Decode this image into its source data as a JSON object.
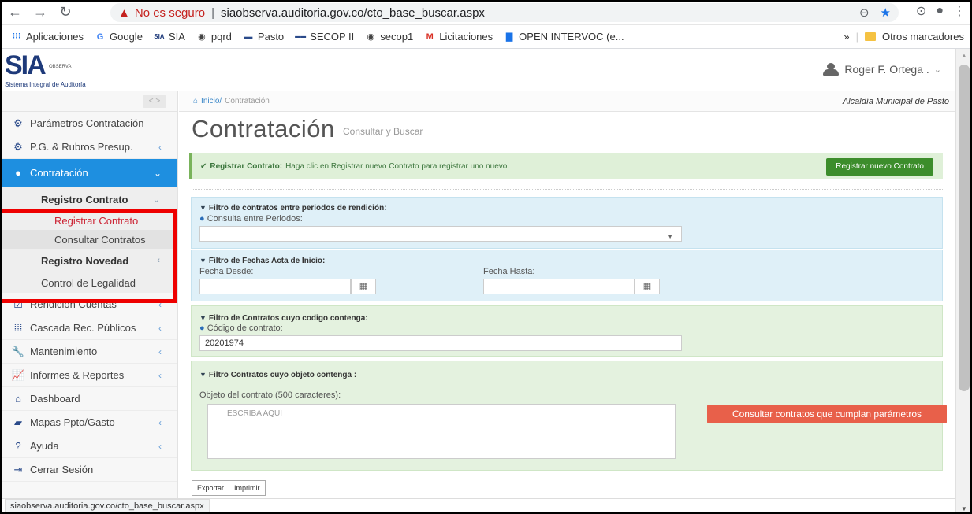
{
  "browser": {
    "warning_label": "No es seguro",
    "url": "siaobserva.auditoria.gov.co/cto_base_buscar.aspx",
    "status_url": "siaobserva.auditoria.gov.co/cto_base_buscar.aspx"
  },
  "bookmarks": {
    "items": [
      "Aplicaciones",
      "Google",
      "SIA",
      "pqrd",
      "Pasto",
      "SECOP II",
      "secop1",
      "Licitaciones",
      "OPEN INTERVOC (e..."
    ],
    "overflow": "»",
    "other": "Otros marcadores"
  },
  "header": {
    "logo_main": "SIA",
    "logo_badge": "OBSERVA",
    "logo_sub": "Sistema Integral de Auditoría",
    "user_name": "Roger F. Ortega ."
  },
  "sidebar": {
    "toggle": "< >",
    "items": [
      {
        "label": "Parámetros Contratación"
      },
      {
        "label": "P.G. & Rubros Presup."
      },
      {
        "label": "Contratación"
      },
      {
        "label": "Rendición Cuentas"
      },
      {
        "label": "Cascada Rec. Públicos"
      },
      {
        "label": "Mantenimiento"
      },
      {
        "label": "Informes & Reportes"
      },
      {
        "label": "Dashboard"
      },
      {
        "label": "Mapas Ppto/Gasto"
      },
      {
        "label": "Ayuda"
      },
      {
        "label": "Cerrar Sesión"
      }
    ],
    "sub": {
      "registro_contrato": "Registro Contrato",
      "registrar_contrato": "Registrar Contrato",
      "consultar_contratos": "Consultar Contratos",
      "registro_novedad": "Registro Novedad",
      "control_legalidad": "Control de Legalidad"
    }
  },
  "breadcrumb": {
    "home": "Inicio/",
    "current": "Contratación",
    "entity": "Alcaldía Municipal de Pasto"
  },
  "page": {
    "title": "Contratación",
    "subtitle": "Consultar y Buscar"
  },
  "alert": {
    "bold": "Registrar Contrato:",
    "text": "Haga clic en Registrar nuevo Contrato para registrar uno nuevo.",
    "button": "Registrar nuevo Contrato"
  },
  "filters": {
    "periodos": {
      "heading": "Filtro de contratos entre periodos de rendición:",
      "label": "Consulta entre Periodos:",
      "value": ""
    },
    "fechas": {
      "heading": "Filtro de Fechas Acta de Inicio:",
      "desde_label": "Fecha Desde:",
      "hasta_label": "Fecha Hasta:",
      "desde_value": "",
      "hasta_value": ""
    },
    "codigo": {
      "heading": "Filtro de Contratos cuyo codigo contenga:",
      "label": "Código de contrato:",
      "value": "20201974"
    },
    "objeto": {
      "heading": "Filtro Contratos cuyo objeto contenga :",
      "label": "Objeto del contrato (500 caracteres):",
      "placeholder": "ESCRIBA AQUÍ"
    }
  },
  "actions": {
    "consultar": "Consultar contratos que cumplan parámetros",
    "exportar": "Exportar",
    "imprimir": "Imprimir"
  }
}
